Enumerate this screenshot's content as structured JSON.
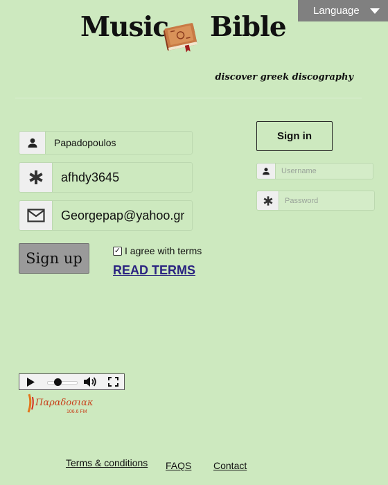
{
  "header": {
    "title_left": "Music",
    "title_right": "Bible",
    "tagline": "discover greek discography",
    "language_label": "Language",
    "icons": {
      "logo": "book-icon",
      "language_toggle": "caret-down-icon"
    }
  },
  "signup": {
    "name_value": "Papadopoulos",
    "password_value": "afhdy3645",
    "email_value": "Georgepap@yahoo.gr",
    "button_label": "Sign up",
    "agree_label": "I agree with terms",
    "agree_checked": true,
    "read_terms_label": "READ TERMS",
    "icons": {
      "name": "person-icon",
      "password": "asterisk-icon",
      "email": "envelope-icon",
      "checkbox": "checkmark-icon"
    }
  },
  "signin": {
    "button_label": "Sign in",
    "username_placeholder": "Username",
    "password_placeholder": "Password",
    "icons": {
      "username": "person-icon",
      "password": "asterisk-icon"
    }
  },
  "player": {
    "icons": [
      "play-icon",
      "volume-icon",
      "fullscreen-icon"
    ]
  },
  "radio": {
    "logo_text": "Παραδοσιακός",
    "logo_subtext": "106.6 FM"
  },
  "footer": {
    "links": [
      "Terms & conditions",
      "FAQS",
      "Contact"
    ]
  },
  "colors": {
    "background": "#cde9bf",
    "language_button": "#808080",
    "signup_button": "#9a9a9a",
    "link_color": "#2a2380"
  }
}
